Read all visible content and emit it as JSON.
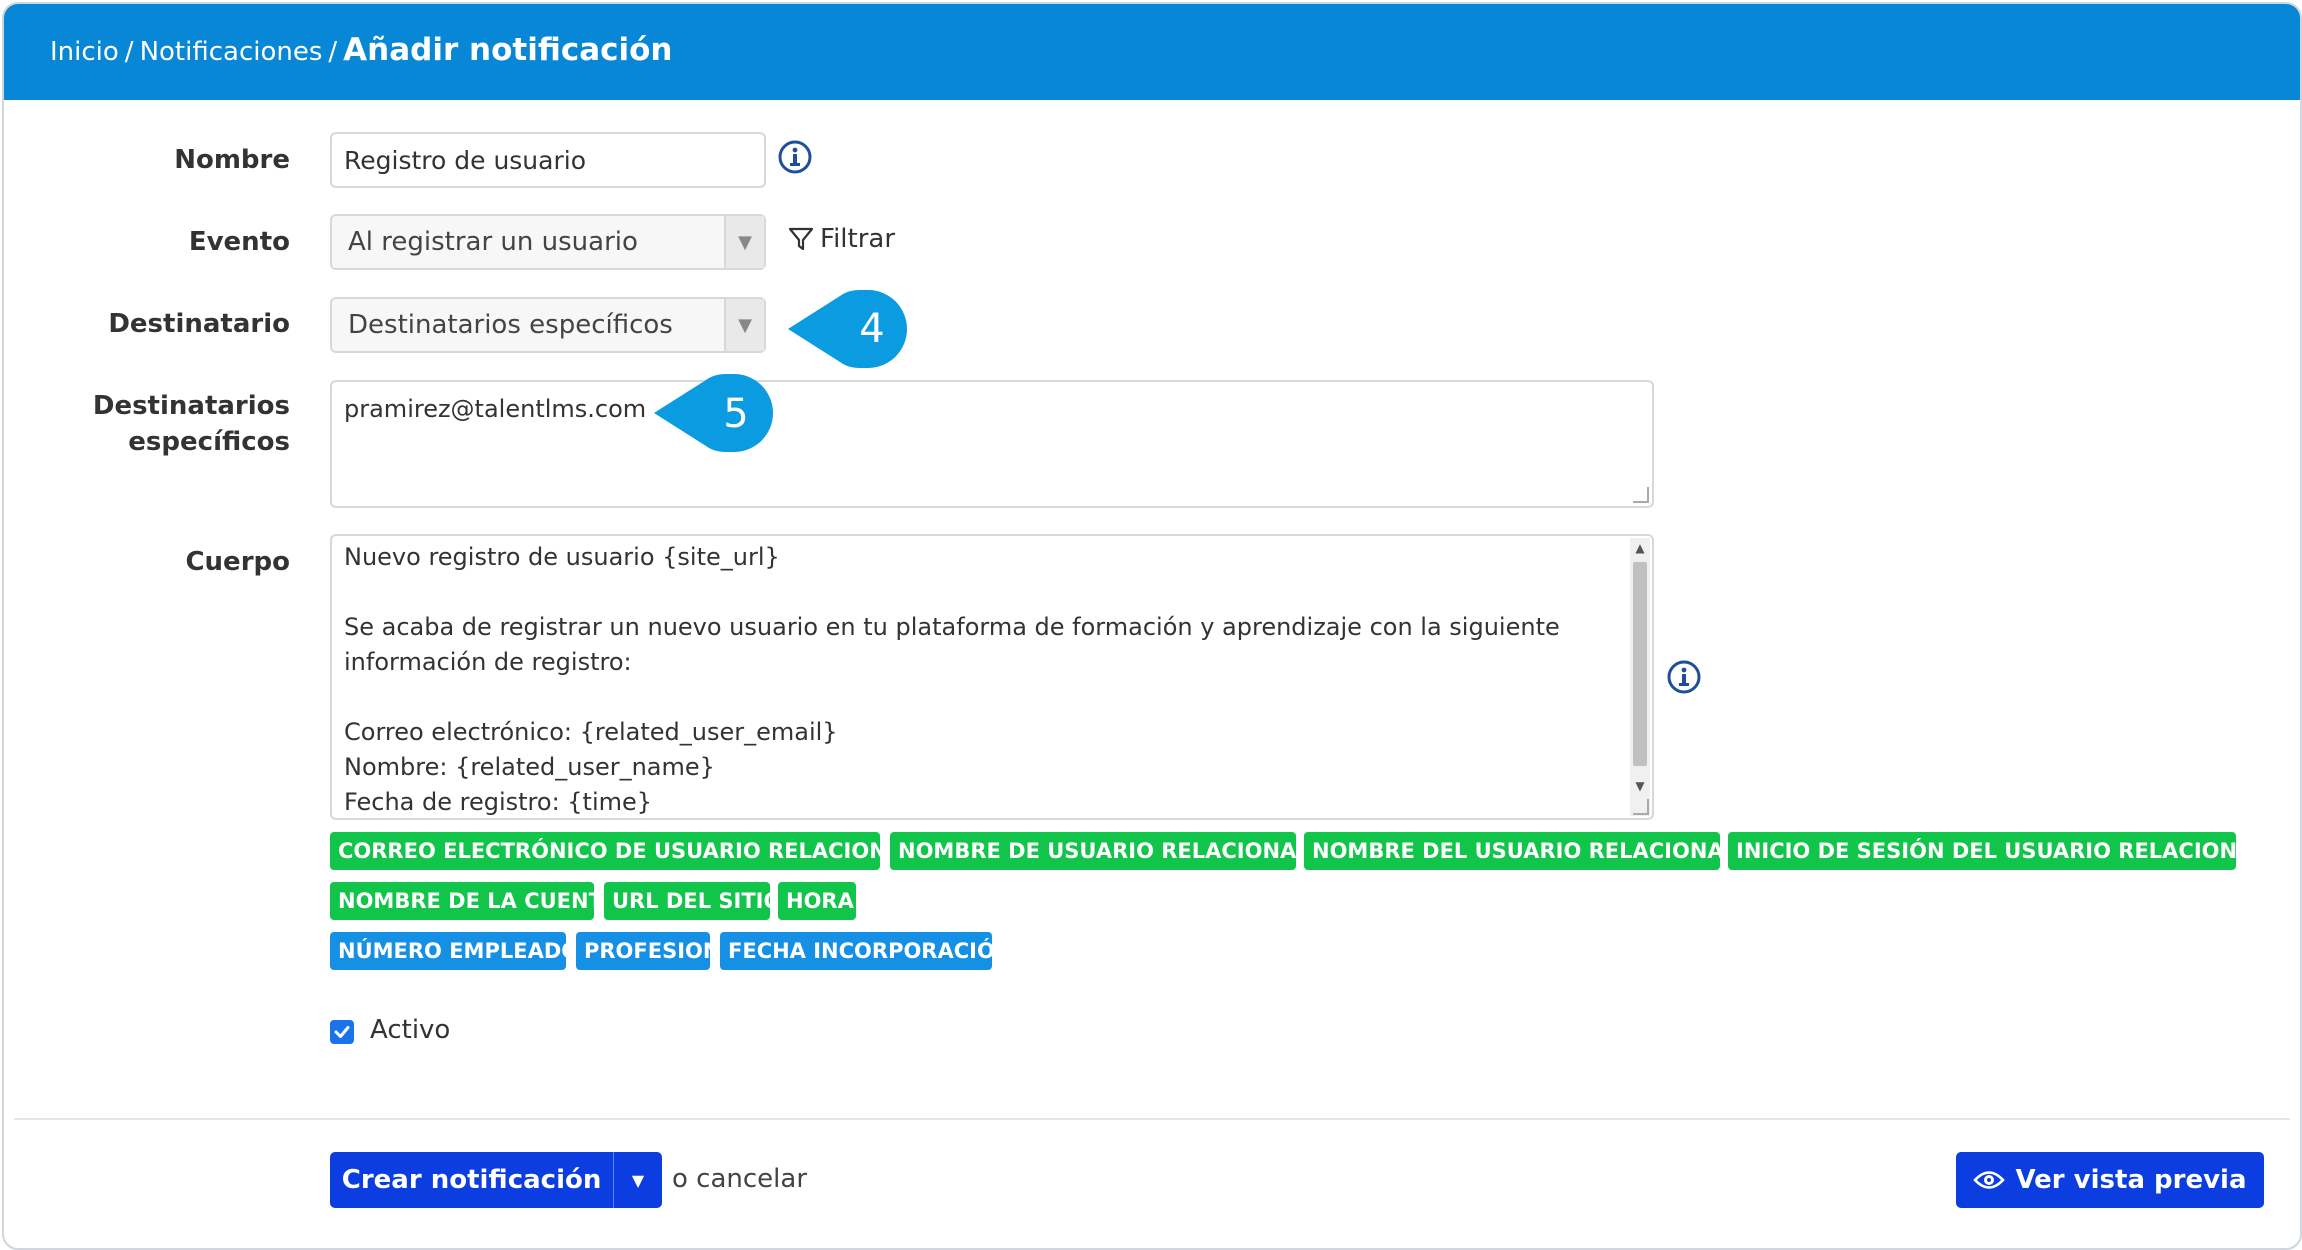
{
  "breadcrumb": {
    "home": "Inicio",
    "section": "Notificaciones",
    "current": "Añadir notificación",
    "separator": "/"
  },
  "form": {
    "name": {
      "label": "Nombre",
      "value": "Registro de usuario"
    },
    "event": {
      "label": "Evento",
      "value": "Al registrar un usuario",
      "filter_label": "Filtrar"
    },
    "recipient": {
      "label": "Destinatario",
      "value": "Destinatarios específicos"
    },
    "specific_recipients": {
      "label_line1": "Destinatarios",
      "label_line2": "específicos",
      "value": "pramirez@talentlms.com"
    },
    "body": {
      "label": "Cuerpo",
      "lines": [
        "Nuevo registro de usuario {site_url}",
        "",
        "Se acaba de registrar un nuevo usuario en tu plataforma de formación y aprendizaje con la siguiente",
        "información de registro:",
        "",
        "Correo electrónico: {related_user_email}",
        "Nombre: {related_user_name}",
        "Fecha de registro: {time}"
      ]
    },
    "active": {
      "label": "Activo",
      "checked": true
    }
  },
  "tags": {
    "row1": [
      "CORREO ELECTRÓNICO DE USUARIO RELACIONADO",
      "NOMBRE DE USUARIO RELACIONADO",
      "NOMBRE DEL USUARIO RELACIONADO",
      "INICIO DE SESIÓN DEL USUARIO RELACIONADO"
    ],
    "row2": [
      "NOMBRE DE LA CUENTA",
      "URL DEL SITIO",
      "HORA"
    ],
    "row3": [
      "NÚMERO EMPLEADO",
      "PROFESION",
      "FECHA INCORPORACIÓN"
    ]
  },
  "callouts": {
    "first": "4",
    "second": "5"
  },
  "actions": {
    "create_label": "Crear notificación",
    "cancel_label": "o cancelar",
    "preview_label": "Ver vista previa"
  },
  "colors": {
    "header": "#0887d6",
    "tag_green": "#11c44a",
    "tag_blue": "#1590e4",
    "primary_button": "#0b3de0",
    "callout": "#0a9be0"
  }
}
